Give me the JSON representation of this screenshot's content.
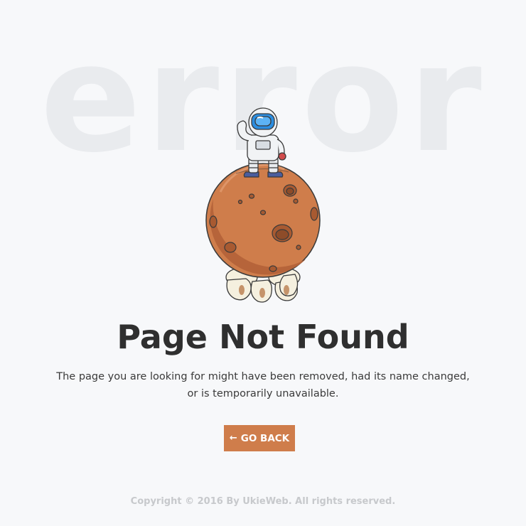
{
  "background_word": "error",
  "title": "Page Not Found",
  "message": {
    "line1": "The page you are looking for might have been removed, had its name changed,",
    "line2": "or is temporarily unavailable."
  },
  "button": {
    "icon": "arrow-left-icon",
    "label": "GO BACK"
  },
  "footer": {
    "copyright": "Copyright © 2016 By UkieWeb. All rights reserved."
  },
  "colors": {
    "background": "#f7f8fa",
    "accent": "#cf7d4b",
    "background_word": "#e9ebee",
    "title": "#2f2f2f",
    "footer_text": "#c7c9cc"
  }
}
